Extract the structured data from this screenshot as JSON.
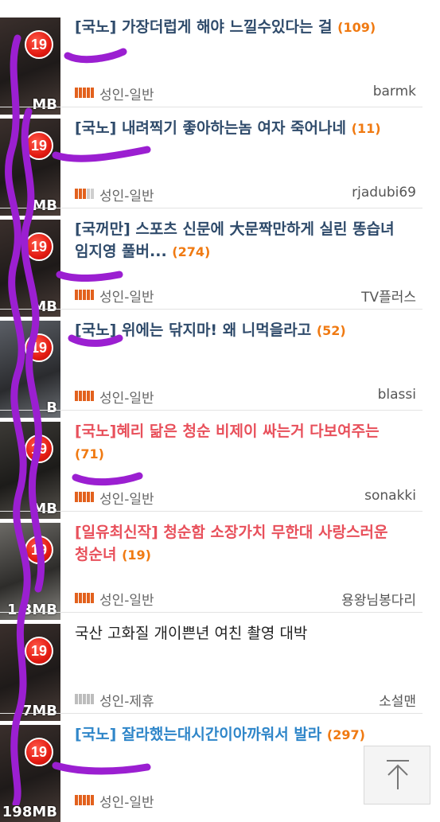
{
  "posts": [
    {
      "title": "[국노] 가장더럽게 해야 느낄수있다는 걸",
      "count": "(109)",
      "size": "MB",
      "rating": 5,
      "category": "성인-일반",
      "author": "barmk",
      "style": "normal",
      "badge": "19"
    },
    {
      "title": "[국노] 내려찍기 좋아하는놈 여자 죽어나네",
      "count": "(11)",
      "size": "MB",
      "rating": 3,
      "category": "성인-일반",
      "author": "rjadubi69",
      "style": "normal",
      "badge": "19"
    },
    {
      "title": "[국꺼만] 스포츠 신문에 大문짝만하게 실린 똥습녀 임지영 풀버...",
      "count": "(274)",
      "size": "MB",
      "rating": 5,
      "category": "성인-일반",
      "author": "TV플러스",
      "style": "normal",
      "badge": "19"
    },
    {
      "title": "[국노] 위에는 닦지마! 왜 니먹을라고",
      "count": "(52)",
      "size": "B",
      "rating": 5,
      "category": "성인-일반",
      "author": "blassi",
      "style": "normal",
      "badge": "19"
    },
    {
      "title": "[국노]혜리 닮은 청순 비제이 싸는거 다보여주는",
      "count": "(71)",
      "size": "MB",
      "rating": 5,
      "category": "성인-일반",
      "author": "sonakki",
      "style": "red",
      "badge": "19"
    },
    {
      "title": "[일유최신작] 청순함 소장가치 무한대 사랑스러운 청순녀",
      "count": "(19)",
      "size": "1 3MB",
      "rating": 5,
      "category": "성인-일반",
      "author": "용왕님봉다리",
      "style": "red",
      "badge": "19"
    },
    {
      "title": "국산 고화질 개이쁜년 여친 촬영 대박",
      "count": "",
      "size": "7MB",
      "rating": 0,
      "category": "성인-제휴",
      "author": "소설맨",
      "style": "plain",
      "badge": "19"
    },
    {
      "title": "[국노] 잘라했는대시간이아까워서 발라",
      "count": "(297)",
      "size": "198MB",
      "rating": 5,
      "category": "성인-일반",
      "author": "",
      "style": "blue",
      "badge": "19"
    }
  ]
}
